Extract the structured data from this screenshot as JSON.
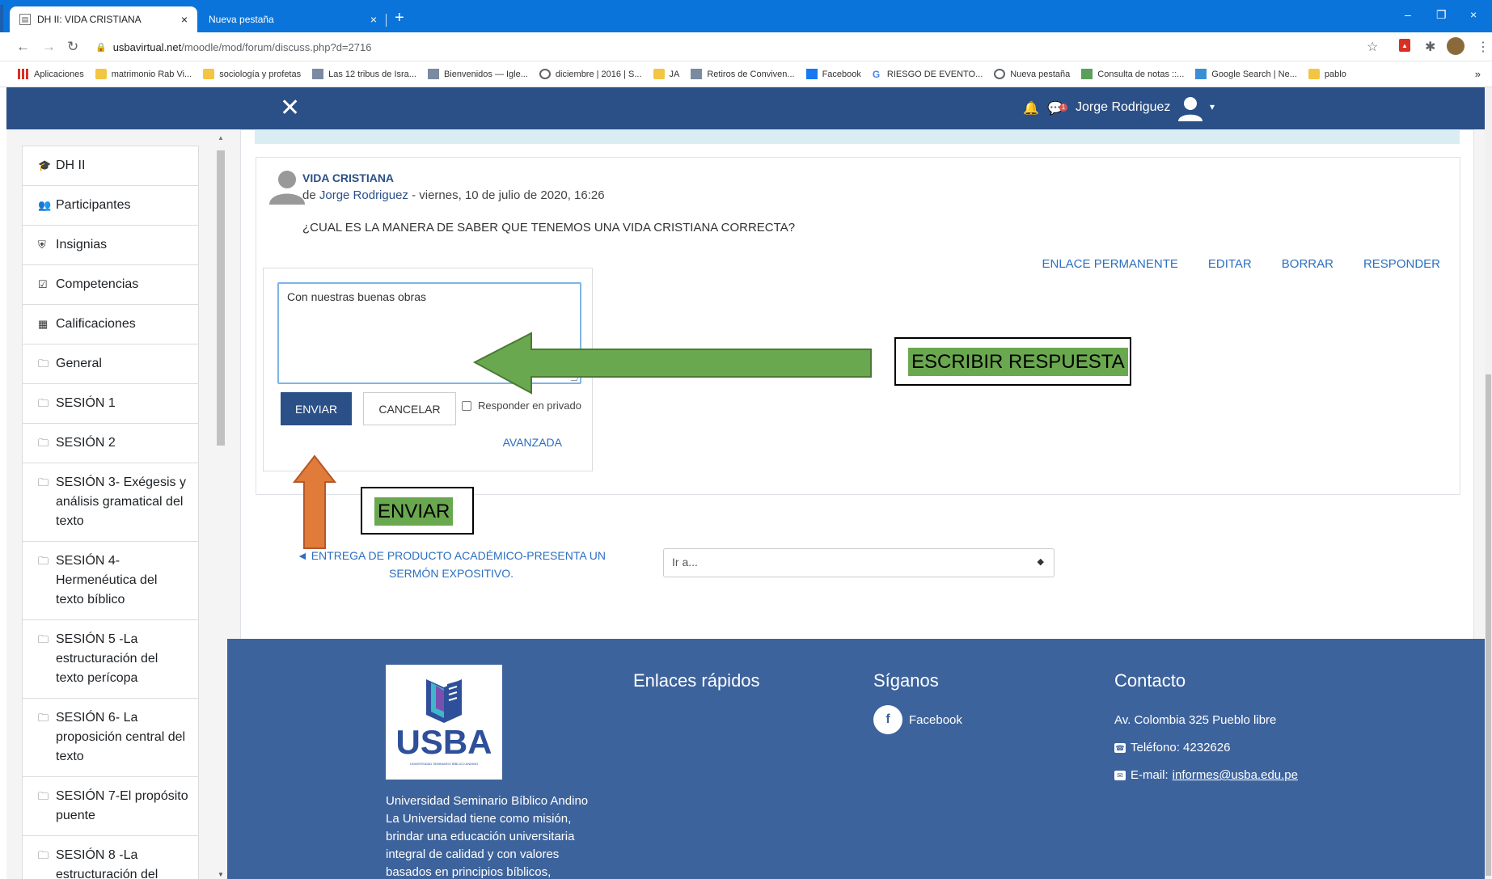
{
  "browser": {
    "tabs": [
      {
        "label": "DH II: VIDA CRISTIANA",
        "close": "×"
      },
      {
        "label": "Nueva pestaña",
        "close": "×"
      }
    ],
    "new_tab": "+",
    "window_controls": {
      "minimize": "–",
      "restore": "❐",
      "close": "×"
    },
    "url_host": "usbavirtual.net",
    "url_path": "/moodle/mod/forum/discuss.php?d=2716",
    "bookmarks": [
      {
        "label": "Aplicaciones",
        "icon": "grid"
      },
      {
        "label": "matrimonio Rab Vi...",
        "icon": "folder"
      },
      {
        "label": "sociología y profetas",
        "icon": "folder"
      },
      {
        "label": "Las 12 tribus de Isra...",
        "icon": "img"
      },
      {
        "label": "Bienvenidos — Igle...",
        "icon": "img"
      },
      {
        "label": "diciembre | 2016 | S...",
        "icon": "globe"
      },
      {
        "label": "JA",
        "icon": "folder"
      },
      {
        "label": "Retiros de Conviven...",
        "icon": "img"
      },
      {
        "label": "Facebook",
        "icon": "fb"
      },
      {
        "label": "RIESGO DE EVENTO...",
        "icon": "g"
      },
      {
        "label": "Nueva pestaña",
        "icon": "globe"
      },
      {
        "label": "Consulta de notas ::...",
        "icon": "cs"
      },
      {
        "label": "Google Search | Ne...",
        "icon": "lst"
      },
      {
        "label": "pablo",
        "icon": "folder"
      }
    ],
    "bookmarks_more": "»"
  },
  "navbar": {
    "close_icon": "✕",
    "user_name": "Jorge Rodriguez",
    "badge": "1",
    "caret": "▾"
  },
  "drawer": {
    "items": [
      {
        "icon": "graduation-cap",
        "glyph": "🎓",
        "label": "DH II"
      },
      {
        "icon": "users",
        "glyph": "👥",
        "label": "Participantes"
      },
      {
        "icon": "shield",
        "glyph": "⛨",
        "label": "Insignias"
      },
      {
        "icon": "check-square",
        "glyph": "☑",
        "label": "Competencias"
      },
      {
        "icon": "table",
        "glyph": "▦",
        "label": "Calificaciones"
      },
      {
        "icon": "folder",
        "glyph": "🗀",
        "label": "General"
      },
      {
        "icon": "folder",
        "glyph": "🗀",
        "label": "SESIÓN 1"
      },
      {
        "icon": "folder",
        "glyph": "🗀",
        "label": "SESIÓN 2"
      },
      {
        "icon": "folder",
        "glyph": "🗀",
        "label": "SESIÓN 3- Exégesis y análisis gramatical del texto"
      },
      {
        "icon": "folder",
        "glyph": "🗀",
        "label": "SESIÓN 4- Hermenéutica del texto bíblico"
      },
      {
        "icon": "folder",
        "glyph": "🗀",
        "label": "SESIÓN 5 -La estructuración del texto perícopa"
      },
      {
        "icon": "folder",
        "glyph": "🗀",
        "label": "SESIÓN 6- La proposición central del texto"
      },
      {
        "icon": "folder",
        "glyph": "🗀",
        "label": "SESIÓN 7-El propósito puente"
      },
      {
        "icon": "folder",
        "glyph": "🗀",
        "label": "SESIÓN 8 -La estructuración del"
      }
    ]
  },
  "post": {
    "subject": "VIDA CRISTIANA",
    "by": "de",
    "author": "Jorge Rodriguez",
    "date": "- viernes, 10 de julio de 2020, 16:26",
    "body": "¿CUAL ES LA MANERA DE SABER QUE TENEMOS UNA VIDA CRISTIANA CORRECTA?",
    "actions": {
      "permalink": "ENLACE PERMANENTE",
      "edit": "EDITAR",
      "delete": "BORRAR",
      "reply": "RESPONDER"
    }
  },
  "reply_form": {
    "text": "Con nuestras buenas obras",
    "send": "ENVIAR",
    "cancel": "CANCELAR",
    "private_label": "Responder en privado",
    "advanced": "AVANZADA"
  },
  "navigation": {
    "prev_arrow": "◄",
    "prev_label": "ENTREGA DE PRODUCTO ACADÉMICO-PRESENTA UN SERMÓN EXPOSITIVO.",
    "jump_placeholder": "Ir a..."
  },
  "footer": {
    "logo_text": "USBA",
    "logo_subtext": "UNIVERSIDAD SEMINARIO BÍBLICO ANDINO",
    "description": "Universidad Seminario Bíblico Andino La Universidad tiene como misión, brindar una educación universitaria integral de calidad y con valores basados en principios bíblicos,",
    "quick_links_title": "Enlaces rápidos",
    "follow_title": "Síganos",
    "facebook": "Facebook",
    "contact_title": "Contacto",
    "address": "Av. Colombia 325 Pueblo libre",
    "phone": "Teléfono: 4232626",
    "email_label": "E-mail:",
    "email": "informes@usba.edu.pe"
  },
  "annotations": {
    "write_reply": "ESCRIBIR RESPUESTA",
    "send": "ENVIAR",
    "green_arrow_color": "#6aa84f",
    "orange_arrow_color": "#e07b39"
  },
  "colors": {
    "browser_blue": "#0b74da",
    "navbar": "#2b5087",
    "footer": "#3d639c",
    "link": "#2b6fc1"
  }
}
